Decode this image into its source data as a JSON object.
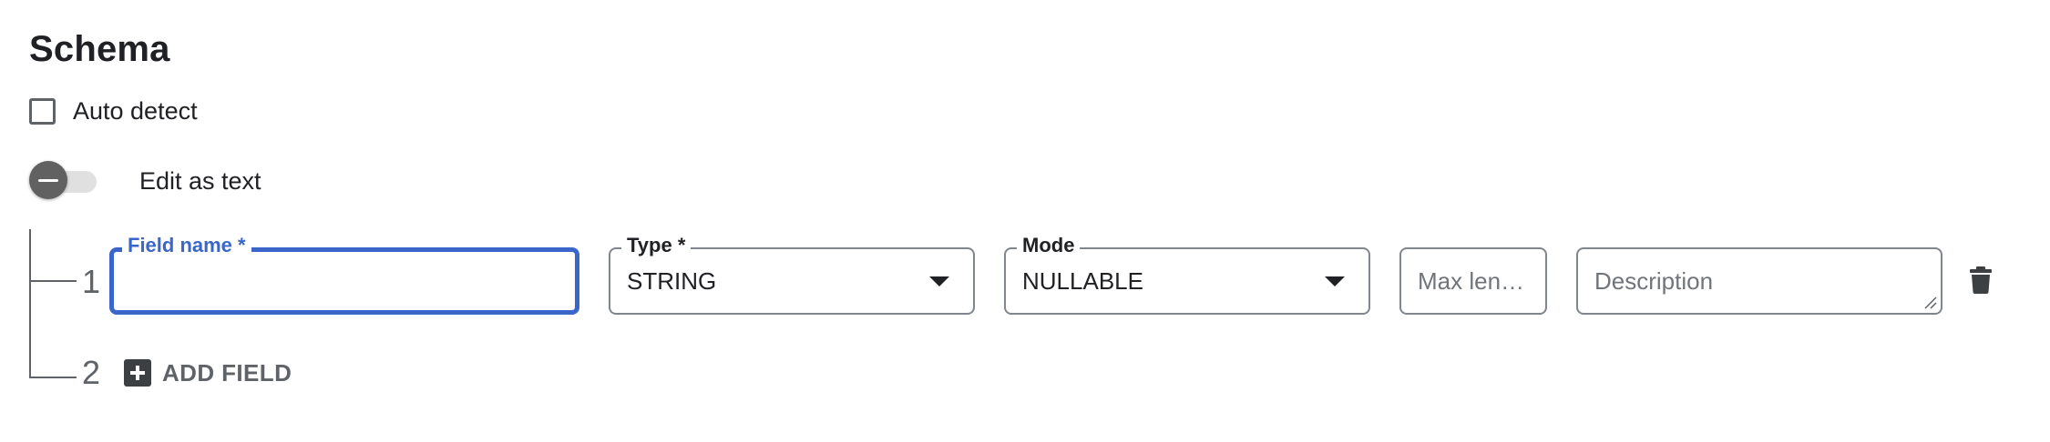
{
  "section": {
    "title": "Schema"
  },
  "auto_detect": {
    "label": "Auto detect",
    "checked": false
  },
  "edit_as_text": {
    "label": "Edit as text",
    "enabled": false
  },
  "fields": [
    {
      "number": "1",
      "field_name": {
        "label": "Field name *",
        "value": ""
      },
      "type": {
        "label": "Type *",
        "value": "STRING"
      },
      "mode": {
        "label": "Mode",
        "value": "NULLABLE"
      },
      "max_length": {
        "placeholder": "Max len…",
        "value": ""
      },
      "description": {
        "placeholder": "Description",
        "value": ""
      },
      "delete_icon": "trash-icon"
    }
  ],
  "add_row": {
    "number": "2",
    "label": "ADD FIELD",
    "icon": "add-box-icon"
  },
  "colors": {
    "focus": "#3b66c9",
    "text": "#202124",
    "muted": "#5f6368",
    "border": "#80868b",
    "toggle_knob": "#616161",
    "toggle_track": "#e0e0e0"
  }
}
